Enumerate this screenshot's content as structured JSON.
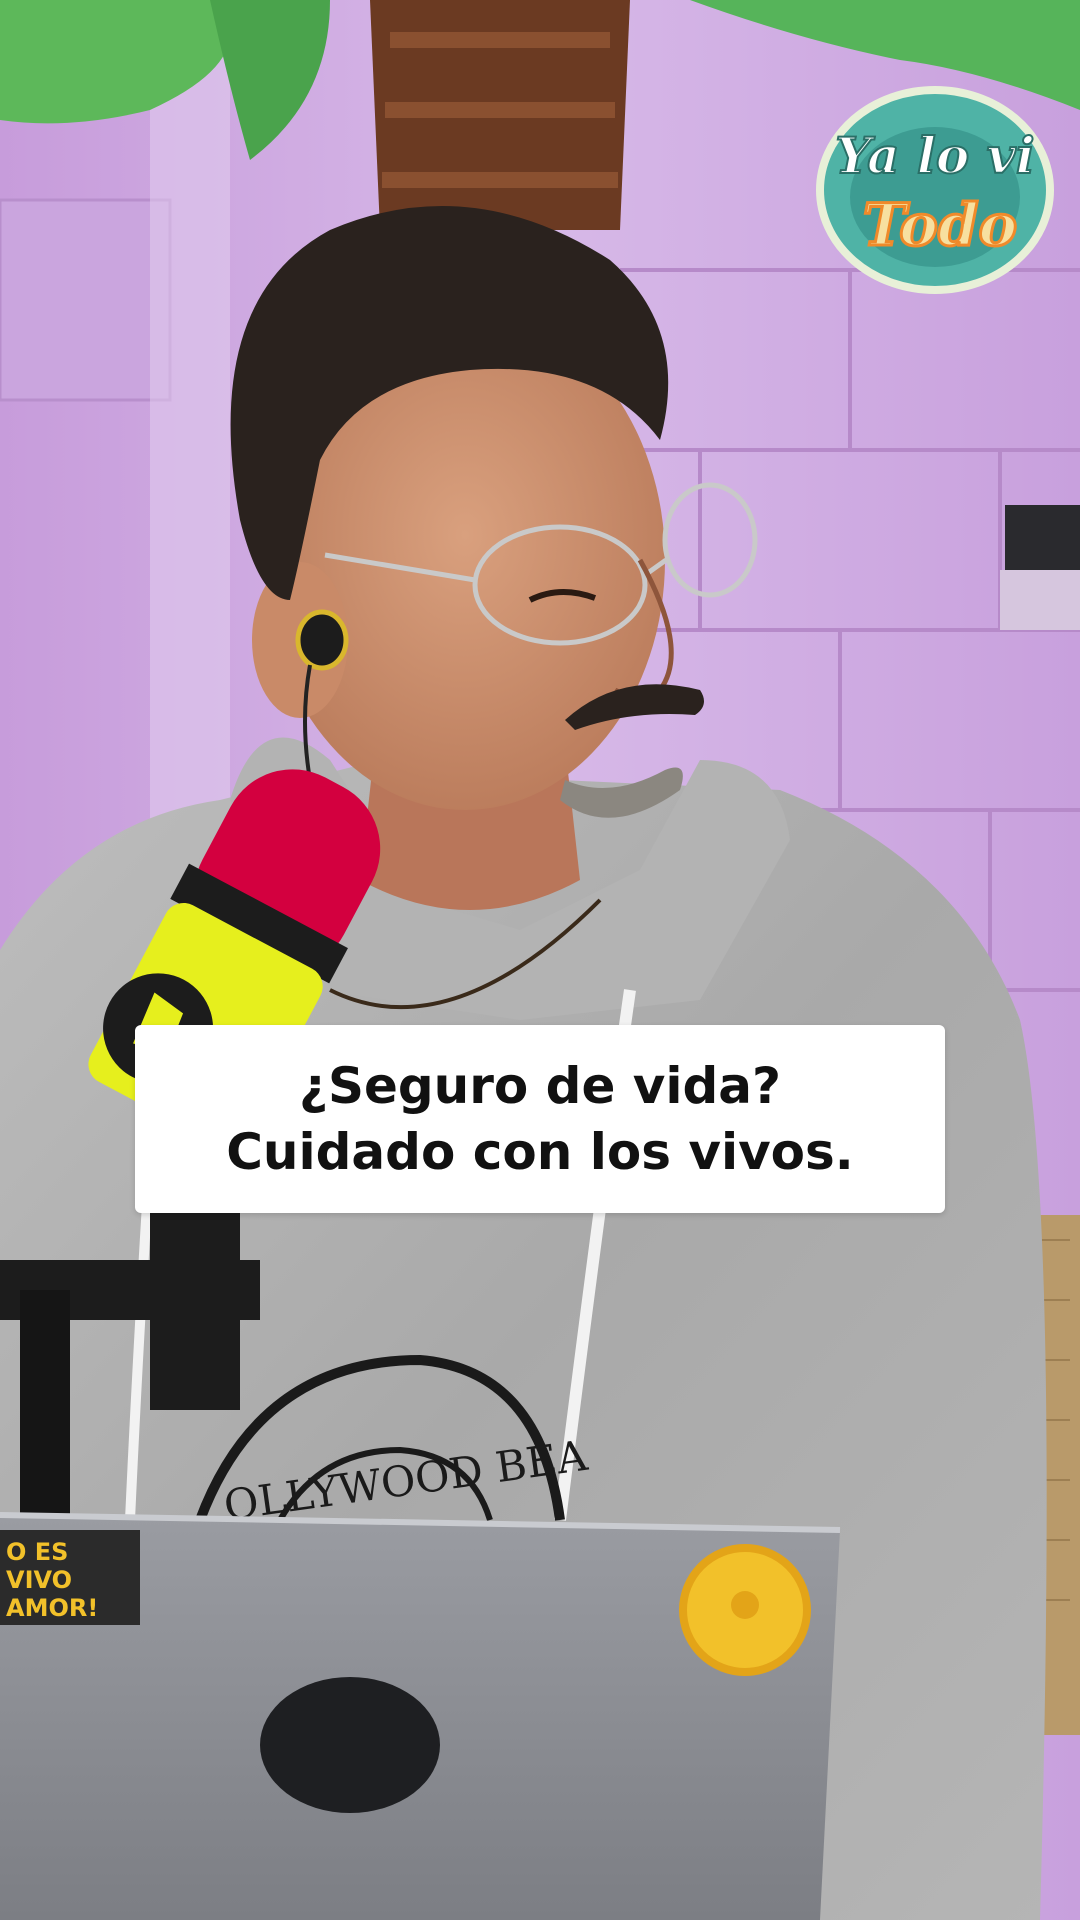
{
  "logo": {
    "line1": "Ya lo vi",
    "line2": "Todo"
  },
  "caption": {
    "line1": "¿Seguro de vida?",
    "line2": "Cuidado con los vivos."
  },
  "scene": {
    "shirt_print": "OLLYWOOD BEA",
    "laptop_sticker": [
      "O ES",
      "VIVO",
      "AMOR!"
    ]
  },
  "colors": {
    "wall": "#c9a4dd",
    "caption_bg": "#ffffff",
    "caption_text": "#111111",
    "logo_teal": "#4fb3a6",
    "logo_orange": "#f08a2a",
    "mic_red": "#d3003f",
    "mic_yellow": "#e6ef1d"
  }
}
